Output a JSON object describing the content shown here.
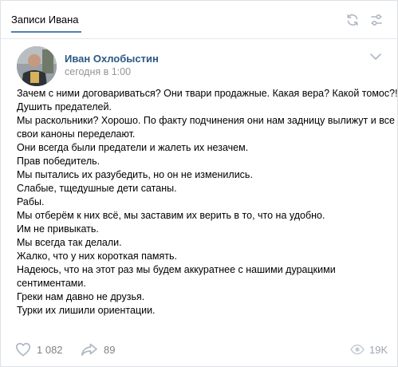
{
  "header": {
    "tab_label": "Записи Ивана",
    "icons": [
      "refresh-icon",
      "settings-icon"
    ]
  },
  "post": {
    "author": "Иван Охлобыстин",
    "date": "сегодня в 1:00",
    "lines": [
      "Зачем с ними договариваться? Они твари продажные. Какая вера? Какой томос?!",
      "Душить предателей.",
      "Мы раскольники? Хорошо. По факту подчинения они нам задницу вылижут и все",
      "свои каноны переделают.",
      "Они всегда были предатели и жалеть их незачем.",
      "Прав победитель.",
      "Мы пытались их разубедить, но он не изменились.",
      "Слабые, тщедушные дети сатаны.",
      "Рабы.",
      "Мы отберём к них всё, мы заставим их верить в то, что на удобно.",
      "Им не привыкать.",
      "Мы всегда так делали.",
      "Жалко, что у них короткая память.",
      "Надеюсь, что на этот раз мы будем аккуратнее с нашими дурацкими",
      "сентиментами.",
      "Греки нам давно не друзья.",
      "Турки их лишили ориентации."
    ]
  },
  "footer": {
    "likes": "1 082",
    "shares": "89",
    "views": "19K"
  },
  "colors": {
    "accent": "#5181b8",
    "author": "#2a5885",
    "muted": "#939393",
    "icon": "#aeb7c2"
  }
}
